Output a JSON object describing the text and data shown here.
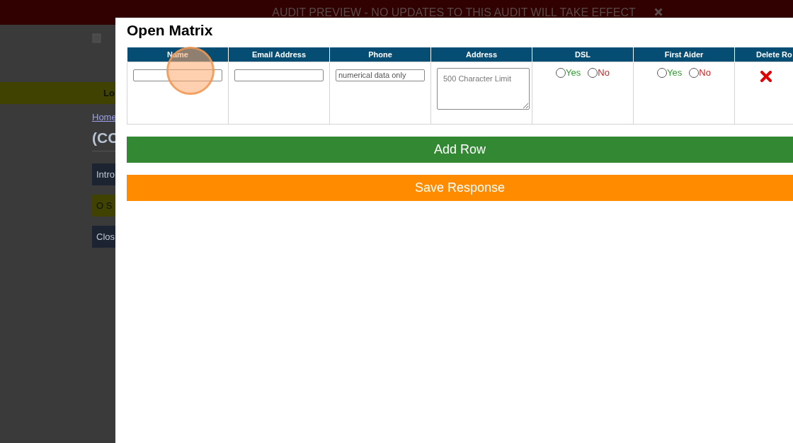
{
  "banner": {
    "text": "AUDIT PREVIEW - NO UPDATES TO THIS AUDIT WILL TAKE EFFECT"
  },
  "background_page": {
    "nav_label": "Lo",
    "breadcrumb": "Home",
    "heading": "(CC",
    "buttons": [
      {
        "label": "Intro",
        "kind": "dark"
      },
      {
        "label": "O S",
        "kind": "olive"
      },
      {
        "label": "Clos",
        "kind": "dark"
      }
    ]
  },
  "modal": {
    "title": "Open Matrix",
    "table": {
      "columns": [
        "Name",
        "Email Address",
        "Phone",
        "Address",
        "DSL",
        "First Aider",
        "Delete Ro"
      ],
      "rows": [
        {
          "cells": [
            {
              "kind": "text"
            },
            {
              "kind": "text"
            },
            {
              "kind": "text",
              "placeholder": "numerical data only"
            },
            {
              "kind": "textarea",
              "placeholder": "500 Character Limit"
            },
            {
              "kind": "radio",
              "options": [
                {
                  "label": "Yes",
                  "selected": false,
                  "color": "#2e9e2e"
                },
                {
                  "label": "No",
                  "selected": false,
                  "color": "#cc1f1f"
                }
              ]
            },
            {
              "kind": "radio",
              "options": [
                {
                  "label": "Yes",
                  "selected": false,
                  "color": "#2e9e2e"
                },
                {
                  "label": "No",
                  "selected": false,
                  "color": "#cc1f1f"
                }
              ]
            },
            {
              "kind": "delete"
            }
          ]
        }
      ]
    },
    "buttons": [
      {
        "label": "Add Row",
        "kind": "add"
      },
      {
        "label": "Save Response",
        "kind": "save"
      }
    ]
  }
}
